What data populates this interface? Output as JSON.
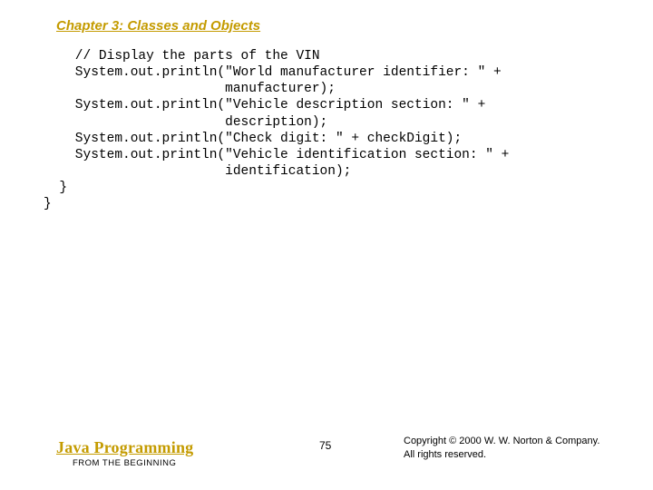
{
  "chapter_title": "Chapter 3: Classes and Objects",
  "code_lines": [
    "    // Display the parts of the VIN",
    "    System.out.println(\"World manufacturer identifier: \" +",
    "                       manufacturer);",
    "    System.out.println(\"Vehicle description section: \" +",
    "                       description);",
    "    System.out.println(\"Check digit: \" + checkDigit);",
    "    System.out.println(\"Vehicle identification section: \" +",
    "                       identification);",
    "  }",
    "}"
  ],
  "footer": {
    "book_main": "Java Programming",
    "book_sub": "FROM THE BEGINNING",
    "page_number": "75",
    "copyright_line1": "Copyright © 2000 W. W. Norton & Company.",
    "copyright_line2": "All rights reserved."
  }
}
